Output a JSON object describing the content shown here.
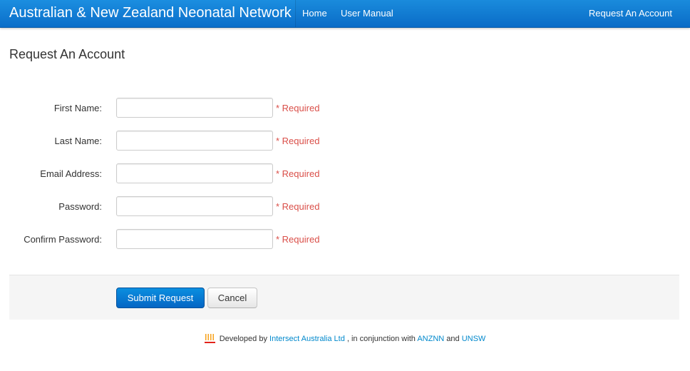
{
  "navbar": {
    "brand": "Australian & New Zealand Neonatal Network",
    "links": [
      {
        "label": "Home"
      },
      {
        "label": "User Manual"
      }
    ],
    "right_link": "Request An Account"
  },
  "page": {
    "title": "Request An Account"
  },
  "form": {
    "required_text": "* Required",
    "fields": [
      {
        "label": "First Name:",
        "value": "",
        "type": "text"
      },
      {
        "label": "Last Name:",
        "value": "",
        "type": "text"
      },
      {
        "label": "Email Address:",
        "value": "",
        "type": "email"
      },
      {
        "label": "Password:",
        "value": "",
        "type": "password"
      },
      {
        "label": "Confirm Password:",
        "value": "",
        "type": "password"
      }
    ],
    "submit_label": "Submit Request",
    "cancel_label": "Cancel"
  },
  "footer": {
    "developed_by": "Developed by",
    "company": "Intersect Australia Ltd",
    "conjunction": ", in conjunction with",
    "partner1": "ANZNN",
    "and_text": "and",
    "partner2": "UNSW",
    "logo_icon": "intersect-logo-icon"
  },
  "colors": {
    "navbar": "#0a6cc7",
    "required": "#da4f49",
    "link": "#0088cc",
    "primary_button": "#0566c4"
  }
}
